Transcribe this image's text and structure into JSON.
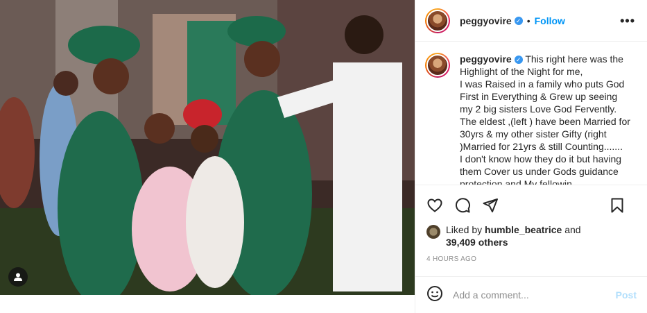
{
  "post": {
    "username": "peggyovire",
    "separator": "•",
    "follow_label": "Follow",
    "more_icon": "more-horizontal-icon",
    "more_label": "•••",
    "caption": "This right here was the Highlight of the Night for me,\nI was Raised in a family who puts God First in Everything & Grew up seeing my 2 big sisters Love God Fervently.\nThe eldest ,(left ) have been Married for 30yrs & my other sister Gifty (right )Married for 21yrs & still Counting.......\nI don't know how they do it but having them Cover us under Gods guidance protection and My fellowin",
    "likes": {
      "prefix": "Liked by ",
      "user": "humble_beatrice",
      "mid": " and",
      "others": "39,409 others"
    },
    "timestamp": "4 HOURS AGO",
    "comment_placeholder": "Add a comment...",
    "post_label": "Post"
  },
  "colors": {
    "accent": "#0095f6",
    "verified": "#3897f0",
    "post_disabled": "#b2dffc",
    "muted": "#8e8e8e"
  },
  "icons": [
    "heart-icon",
    "comment-icon",
    "share-icon",
    "bookmark-icon",
    "emoji-icon",
    "user-tag-icon",
    "verified-badge-icon"
  ]
}
